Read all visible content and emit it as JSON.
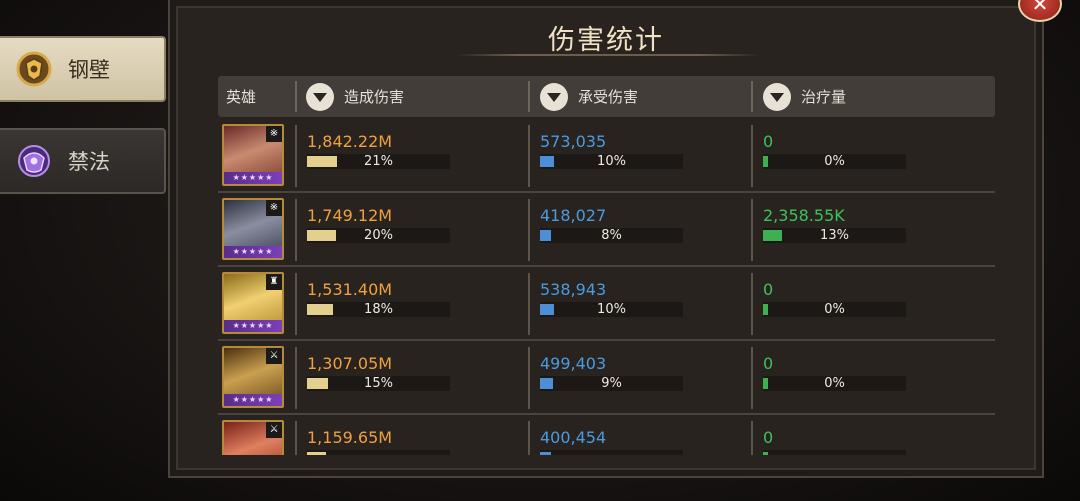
{
  "tabs": [
    {
      "label": "钢壁",
      "active": true,
      "icon": "shield-crest-icon"
    },
    {
      "label": "禁法",
      "active": false,
      "icon": "purple-crest-icon"
    }
  ],
  "title": "伤害统计",
  "close_icon": "close-icon",
  "columns": {
    "hero": "英雄",
    "damage_dealt": "造成伤害",
    "damage_taken": "承受伤害",
    "healing": "治疗量"
  },
  "colors": {
    "damage": "#f0a040",
    "taken": "#4c9ae0",
    "heal": "#3dc25a",
    "stars": "#7b3fb8"
  },
  "rows": [
    {
      "stars": "★★★★★",
      "badge": "※",
      "dealt": "1,842.22M",
      "dealt_pct": "21%",
      "dealt_frac": 0.21,
      "taken": "573,035",
      "taken_pct": "10%",
      "taken_frac": 0.1,
      "heal": "0",
      "heal_pct": "0%",
      "heal_frac": 0.0
    },
    {
      "stars": "★★★★★",
      "badge": "※",
      "dealt": "1,749.12M",
      "dealt_pct": "20%",
      "dealt_frac": 0.2,
      "taken": "418,027",
      "taken_pct": "8%",
      "taken_frac": 0.08,
      "heal": "2,358.55K",
      "heal_pct": "13%",
      "heal_frac": 0.13
    },
    {
      "stars": "★★★★★",
      "badge": "♜",
      "dealt": "1,531.40M",
      "dealt_pct": "18%",
      "dealt_frac": 0.18,
      "taken": "538,943",
      "taken_pct": "10%",
      "taken_frac": 0.1,
      "heal": "0",
      "heal_pct": "0%",
      "heal_frac": 0.0
    },
    {
      "stars": "★★★★★",
      "badge": "⚔",
      "dealt": "1,307.05M",
      "dealt_pct": "15%",
      "dealt_frac": 0.15,
      "taken": "499,403",
      "taken_pct": "9%",
      "taken_frac": 0.09,
      "heal": "0",
      "heal_pct": "0%",
      "heal_frac": 0.0
    },
    {
      "stars": "★★★★★",
      "badge": "⚔",
      "dealt": "1,159.65M",
      "dealt_pct": "",
      "dealt_frac": 0.13,
      "taken": "400,454",
      "taken_pct": "",
      "taken_frac": 0.08,
      "heal": "0",
      "heal_pct": "",
      "heal_frac": 0.0
    }
  ]
}
